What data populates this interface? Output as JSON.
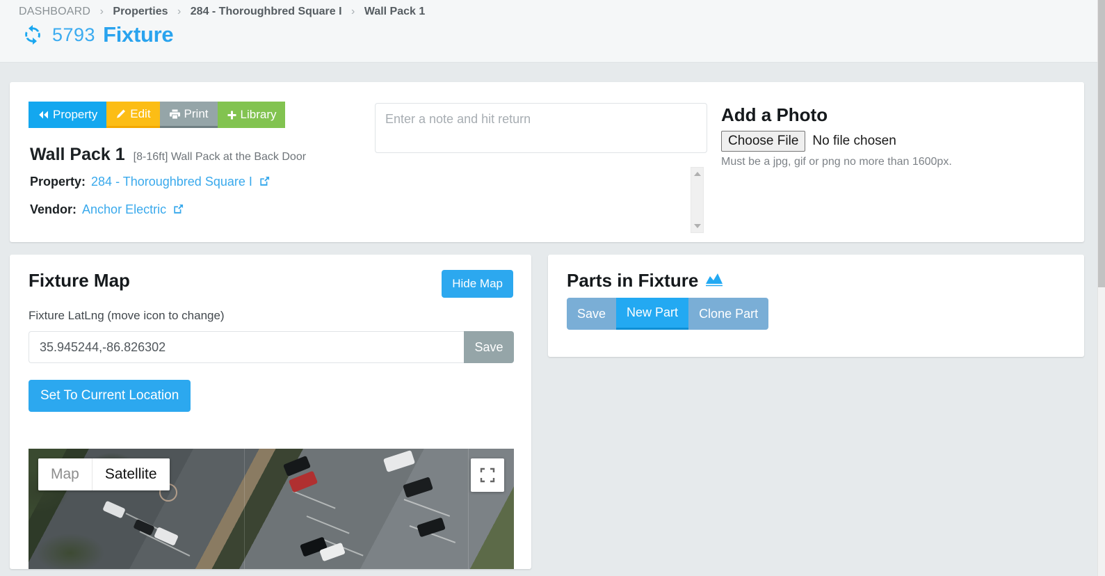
{
  "header": {
    "breadcrumb": [
      {
        "label": "DASHBOARD"
      },
      {
        "label": "Properties"
      },
      {
        "label": "284 - Thoroughbred Square I"
      },
      {
        "label": "Wall Pack 1"
      }
    ],
    "separator": "›",
    "record_id": "5793",
    "record_type": "Fixture",
    "sync_icon": "sync-refresh-icon"
  },
  "toolbar": {
    "property_label": "Property",
    "edit_label": "Edit",
    "print_label": "Print",
    "library_label": "Library",
    "icons": {
      "property": "double-chevron-left-icon",
      "edit": "pencil-icon",
      "print": "printer-icon",
      "library": "plus-icon"
    }
  },
  "fixture": {
    "name": "Wall Pack 1",
    "description": "[8-16ft] Wall Pack at the Back Door",
    "property_label": "Property:",
    "property_value": "284 - Thoroughbred Square I",
    "vendor_label": "Vendor:",
    "vendor_value": "Anchor Electric",
    "external_link_icon": "external-link-icon"
  },
  "notes": {
    "placeholder": "Enter a note and hit return",
    "value": ""
  },
  "photo": {
    "title": "Add a Photo",
    "choose_file_label": "Choose File",
    "file_status": "No file chosen",
    "hint": "Must be a jpg, gif or png no more than 1600px."
  },
  "map_panel": {
    "title": "Fixture Map",
    "hide_map_label": "Hide Map",
    "latlng_label": "Fixture LatLng (move icon to change)",
    "latlng_value": "35.945244,-86.826302",
    "save_label": "Save",
    "set_location_label": "Set To Current Location",
    "map_type_map": "Map",
    "map_type_satellite": "Satellite",
    "selected_map_type": "Satellite",
    "fullscreen_icon": "fullscreen-icon"
  },
  "parts_panel": {
    "title": "Parts in Fixture",
    "chart_icon": "area-chart-icon",
    "save_label": "Save",
    "new_part_label": "New Part",
    "clone_part_label": "Clone Part",
    "active_button": "New Part"
  },
  "colors": {
    "primary_blue": "#13a7ef",
    "accent_blue": "#29a3ee",
    "edit_yellow": "#fcbd15",
    "print_gray": "#95a5a8",
    "library_green": "#82c350",
    "muted_blue": "#7aaed6",
    "page_background": "#e6eaec"
  }
}
